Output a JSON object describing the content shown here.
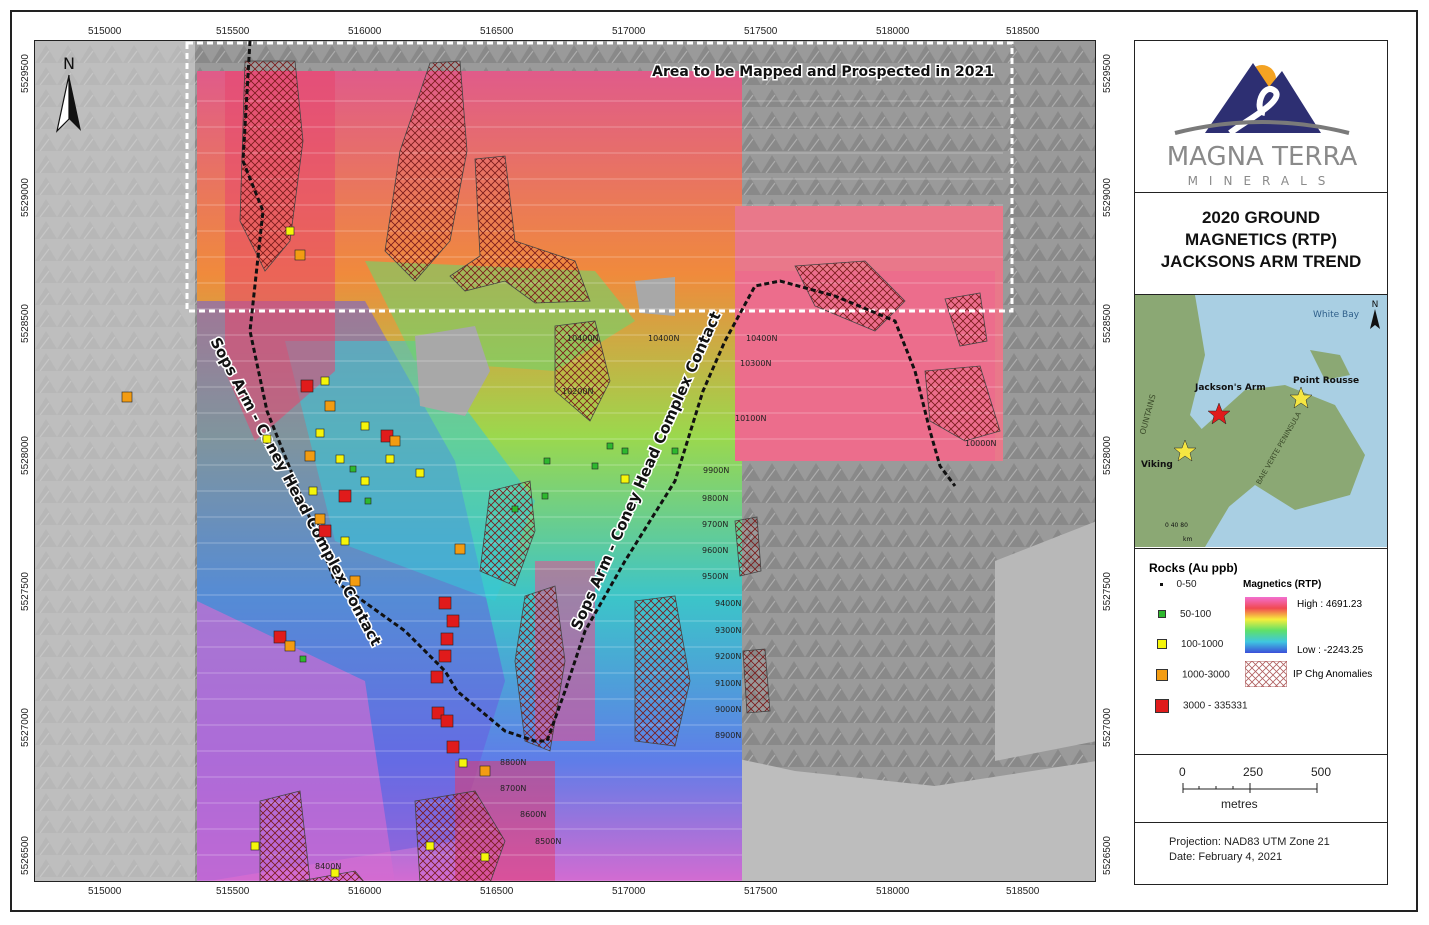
{
  "map": {
    "x_ticks": [
      "515000",
      "515500",
      "516000",
      "516500",
      "517000",
      "517500",
      "518000",
      "518500"
    ],
    "y_ticks": [
      "5529500",
      "5529000",
      "5528500",
      "5528000",
      "5527500",
      "5527000",
      "5526500"
    ],
    "north_label": "N",
    "area_label": "Area to be Mapped and Prospected in 2021",
    "contact_label_left": "Sops Arm - Coney Head Complex Contact",
    "contact_label_right": "Sops Arm - Coney Head Complex Contact",
    "line_labels": [
      "10400N",
      "10400N",
      "10400N",
      "10300N",
      "10200N",
      "10100N",
      "10000N",
      "9900N",
      "9800N",
      "9700N",
      "9600N",
      "9500N",
      "9400N",
      "9300N",
      "9200N",
      "9100N",
      "9000N",
      "8900N",
      "8800N",
      "8700N",
      "8600N",
      "8500N",
      "8400N"
    ]
  },
  "logo": {
    "name_line1": "MAGNA TERRA",
    "name_line2": "MINERALS",
    "colors": {
      "mountain": "#2d2f72",
      "sun": "#f4a323",
      "swoosh": "#7a7a7a",
      "text": "#8a8a8a"
    }
  },
  "title": {
    "line1": "2020 GROUND",
    "line2": "MAGNETICS (RTP)",
    "line3": "JACKSONS ARM TREND"
  },
  "inset": {
    "labels": {
      "white_bay": "White Bay",
      "jacksons_arm": "Jackson's Arm",
      "point_rousse": "Point Rousse",
      "viking": "Viking",
      "north": "N",
      "baie_verte": "BAIE VERTE PENINSULA",
      "mountains": "OUNTAINS",
      "scale": "0   40   80",
      "scale_unit": "km"
    },
    "colors": {
      "water": "#a9cfe3",
      "land": "#8ba874"
    }
  },
  "legend": {
    "rocks_title": "Rocks (Au ppb)",
    "rocks": [
      {
        "label": "0-50",
        "color": "#111111",
        "size": 3
      },
      {
        "label": "50-100",
        "color": "#2eb82e",
        "size": 6
      },
      {
        "label": "100-1000",
        "color": "#f5f50a",
        "size": 8
      },
      {
        "label": "1000-3000",
        "color": "#f39c12",
        "size": 10
      },
      {
        "label": "3000 - 335331",
        "color": "#e01b1b",
        "size": 12
      }
    ],
    "mag_title": "Magnetics (RTP)",
    "mag_high": "High : 4691.23",
    "mag_low": "Low : -2243.25",
    "ip_label": "IP Chg Anomalies"
  },
  "scale": {
    "labels": [
      "0",
      "250",
      "500"
    ],
    "unit": "metres"
  },
  "projection": {
    "line1": "Projection: NAD83 UTM Zone 21",
    "line2": "Date: February 4, 2021"
  }
}
